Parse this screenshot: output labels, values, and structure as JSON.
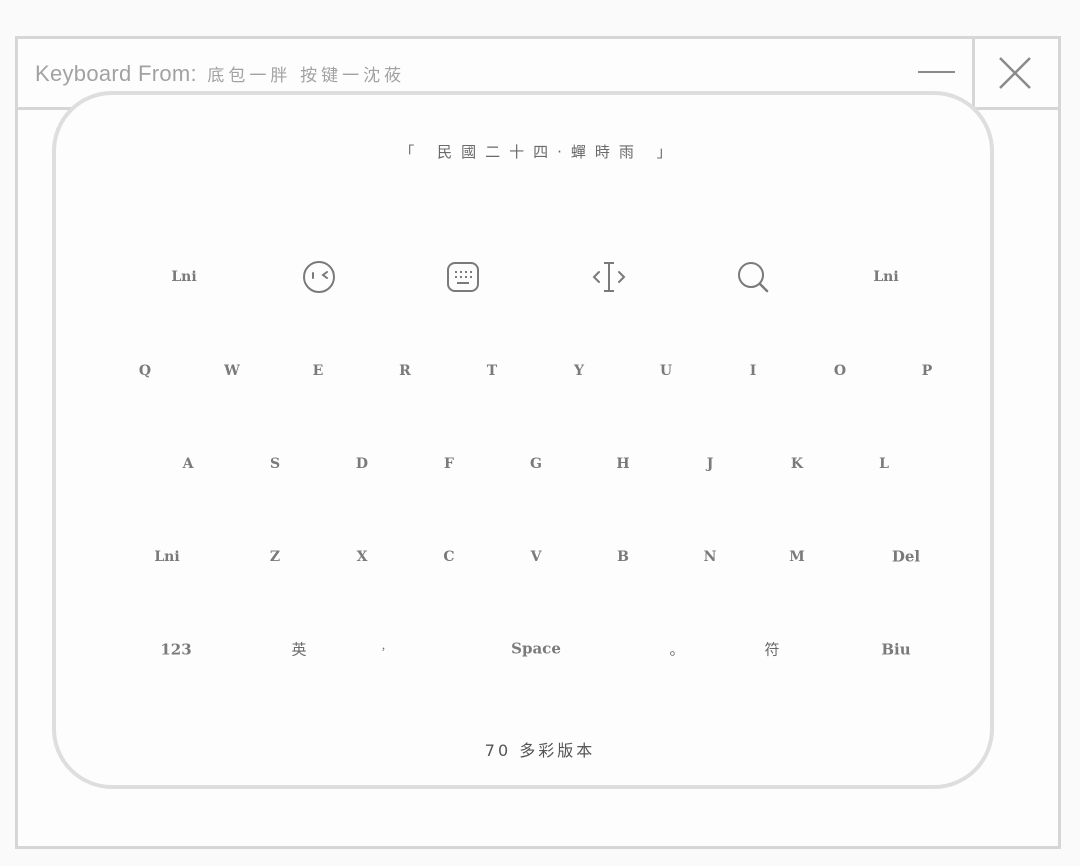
{
  "window": {
    "title_prefix": "Keyboard From:",
    "title_credits": "底包一胖  按键一沈莜"
  },
  "keyboard": {
    "poem": "「 民國二十四·蟬時雨 」",
    "top_row": [
      {
        "type": "text",
        "label": "Lni",
        "name": "key-lni-left"
      },
      {
        "type": "icon",
        "icon": "emoji-face-icon",
        "name": "emoji-face-icon"
      },
      {
        "type": "icon",
        "icon": "keyboard-icon",
        "name": "keyboard-icon"
      },
      {
        "type": "icon",
        "icon": "cursor-move-icon",
        "name": "cursor-move-icon"
      },
      {
        "type": "icon",
        "icon": "search-icon",
        "name": "search-icon"
      },
      {
        "type": "text",
        "label": "Lni",
        "name": "key-lni-right"
      }
    ],
    "row1": [
      "Q",
      "W",
      "E",
      "R",
      "T",
      "Y",
      "U",
      "I",
      "O",
      "P"
    ],
    "row2": [
      "A",
      "S",
      "D",
      "F",
      "G",
      "H",
      "J",
      "K",
      "L"
    ],
    "row3": [
      "Lni",
      "Z",
      "X",
      "C",
      "V",
      "B",
      "N",
      "M",
      "Del"
    ],
    "row4": [
      "123",
      "英",
      "，",
      "Space",
      "。",
      "符",
      "Biu"
    ],
    "footer": "70 多彩版本"
  }
}
